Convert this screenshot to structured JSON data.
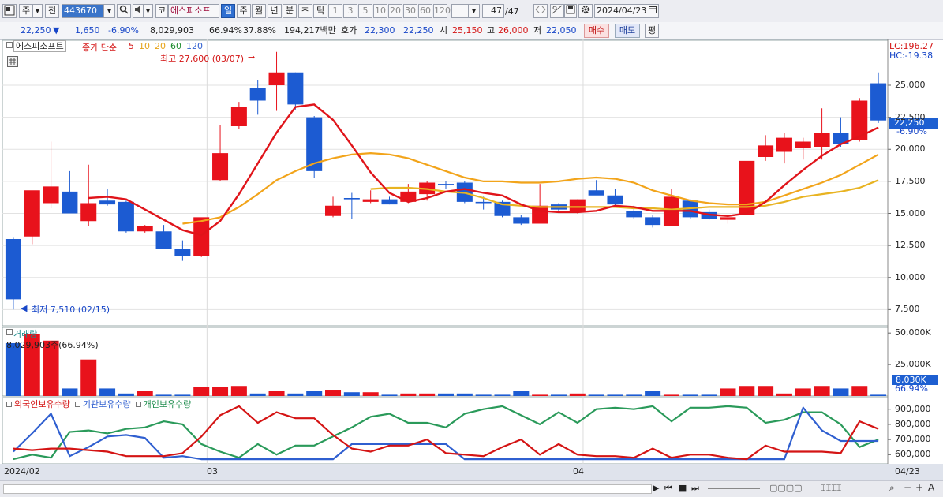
{
  "toolbar": {
    "menu_icon": "window-icon",
    "market_label": "주",
    "prev_label": "전",
    "stock_code": "443670",
    "search_icon": "search-icon",
    "sound_icon": "speaker-icon",
    "code_label": "코",
    "stock_name": "에스피소프",
    "periods": [
      "일",
      "주",
      "월",
      "년",
      "분",
      "초",
      "틱"
    ],
    "active_period": "일",
    "intervals": [
      "1",
      "3",
      "5",
      "10",
      "20",
      "30",
      "60",
      "120"
    ],
    "count": "47",
    "count_total": "/47",
    "date": "2024/04/23"
  },
  "quote": {
    "price": "22,250",
    "change": "1,650",
    "change_pct": "-6.90%",
    "volume": "8,029,903",
    "vol_ratio": "66.94%",
    "turnover": "37.88%",
    "amount": "194,217백만",
    "bid_label": "호가",
    "bid1": "22,300",
    "bid2": "22,250",
    "open_label": "시",
    "open": "25,150",
    "high_label": "고",
    "high": "26,000",
    "low_label": "저",
    "low": "22,050",
    "buy_label": "매수",
    "sell_label": "매도",
    "eval_label": "평"
  },
  "price_panel": {
    "stock_name": "에스피소프트",
    "ma_title": "종가 단순",
    "ma_periods": [
      {
        "label": "5",
        "color": "#d41414"
      },
      {
        "label": "10",
        "color": "#e3a21b"
      },
      {
        "label": "20",
        "color": "#e8a316"
      },
      {
        "label": "60",
        "color": "#1a8a2a"
      },
      {
        "label": "120",
        "color": "#2f5fd0"
      }
    ],
    "lc": "LC:196.27",
    "hc": "HC:-19.38",
    "max_note": "최고 27,600 (03/07)",
    "min_note": "최저 7,510 (02/15)",
    "current_price": "22,250",
    "current_pct": "-6.90%",
    "y_ticks": [
      "25,000",
      "22,500",
      "20,000",
      "17,500",
      "15,000",
      "12,500",
      "10,000",
      "7,500"
    ]
  },
  "volume_panel": {
    "title": "거래량",
    "note": "8,029,903주(66.94%)",
    "current": "8,030K",
    "current_pct": "66.94%",
    "y_ticks": [
      "50,000K",
      "25,000K"
    ]
  },
  "holding_panel": {
    "series": [
      {
        "name": "외국인보유수량",
        "color": "#d41414"
      },
      {
        "name": "기관보유수량",
        "color": "#2f5fd0"
      },
      {
        "name": "개인보유수량",
        "color": "#1a8a4a"
      }
    ],
    "y_ticks": [
      "900,000",
      "800,000",
      "700,000",
      "600,000"
    ]
  },
  "x_axis": {
    "labels": [
      "2024/02",
      "03",
      "04"
    ],
    "right_label": "04/23"
  },
  "chart_data": {
    "type": "candlestick",
    "price_ylim": [
      6600,
      28200
    ],
    "candles": [
      {
        "o": 13000,
        "h": 13100,
        "l": 7510,
        "c": 8300
      },
      {
        "o": 13200,
        "h": 15900,
        "l": 12600,
        "c": 16800
      },
      {
        "o": 15800,
        "h": 20600,
        "l": 15400,
        "c": 17100
      },
      {
        "o": 16700,
        "h": 18300,
        "l": 15000,
        "c": 15000
      },
      {
        "o": 14400,
        "h": 18800,
        "l": 14000,
        "c": 15800
      },
      {
        "o": 16000,
        "h": 16900,
        "l": 15600,
        "c": 15700
      },
      {
        "o": 15900,
        "h": 16000,
        "l": 13500,
        "c": 13600
      },
      {
        "o": 13600,
        "h": 14100,
        "l": 13500,
        "c": 14000
      },
      {
        "o": 13600,
        "h": 14100,
        "l": 12200,
        "c": 12200
      },
      {
        "o": 12200,
        "h": 12900,
        "l": 11300,
        "c": 11700
      },
      {
        "o": 11700,
        "h": 14400,
        "l": 11600,
        "c": 14700
      },
      {
        "o": 17600,
        "h": 21900,
        "l": 17500,
        "c": 19700
      },
      {
        "o": 21800,
        "h": 23700,
        "l": 21600,
        "c": 23300
      },
      {
        "o": 24800,
        "h": 25400,
        "l": 22700,
        "c": 23800
      },
      {
        "o": 25000,
        "h": 27600,
        "l": 23000,
        "c": 26000
      },
      {
        "o": 26000,
        "h": 26000,
        "l": 23100,
        "c": 23500
      },
      {
        "o": 22500,
        "h": 22600,
        "l": 17800,
        "c": 18300
      },
      {
        "o": 14800,
        "h": 16300,
        "l": 14700,
        "c": 15600
      },
      {
        "o": 16200,
        "h": 16600,
        "l": 14600,
        "c": 16100
      },
      {
        "o": 15900,
        "h": 16800,
        "l": 15800,
        "c": 16100
      },
      {
        "o": 16100,
        "h": 16300,
        "l": 15700,
        "c": 15700
      },
      {
        "o": 15900,
        "h": 17300,
        "l": 15800,
        "c": 16700
      },
      {
        "o": 16500,
        "h": 17500,
        "l": 16000,
        "c": 17400
      },
      {
        "o": 17300,
        "h": 17500,
        "l": 16900,
        "c": 17200
      },
      {
        "o": 17400,
        "h": 17500,
        "l": 15800,
        "c": 15900
      },
      {
        "o": 15900,
        "h": 16300,
        "l": 15300,
        "c": 15800
      },
      {
        "o": 15900,
        "h": 16000,
        "l": 14700,
        "c": 14800
      },
      {
        "o": 14700,
        "h": 14900,
        "l": 14100,
        "c": 14200
      },
      {
        "o": 14200,
        "h": 17300,
        "l": 14200,
        "c": 15600
      },
      {
        "o": 15700,
        "h": 15800,
        "l": 15100,
        "c": 15300
      },
      {
        "o": 15100,
        "h": 16100,
        "l": 15000,
        "c": 16100
      },
      {
        "o": 16800,
        "h": 17600,
        "l": 16700,
        "c": 16400
      },
      {
        "o": 16400,
        "h": 16900,
        "l": 15500,
        "c": 15700
      },
      {
        "o": 15200,
        "h": 15600,
        "l": 14600,
        "c": 14700
      },
      {
        "o": 14700,
        "h": 14900,
        "l": 13900,
        "c": 14100
      },
      {
        "o": 14000,
        "h": 16900,
        "l": 14000,
        "c": 16300
      },
      {
        "o": 16000,
        "h": 16100,
        "l": 14600,
        "c": 14700
      },
      {
        "o": 15100,
        "h": 15300,
        "l": 14500,
        "c": 14600
      },
      {
        "o": 14500,
        "h": 14900,
        "l": 14200,
        "c": 14700
      },
      {
        "o": 14900,
        "h": 15700,
        "l": 14900,
        "c": 19100
      },
      {
        "o": 19400,
        "h": 21100,
        "l": 19100,
        "c": 20300
      },
      {
        "o": 19800,
        "h": 21300,
        "l": 18900,
        "c": 20900
      },
      {
        "o": 20100,
        "h": 20900,
        "l": 19200,
        "c": 20600
      },
      {
        "o": 20200,
        "h": 23200,
        "l": 19200,
        "c": 21300
      },
      {
        "o": 21300,
        "h": 22500,
        "l": 20200,
        "c": 20400
      },
      {
        "o": 20700,
        "h": 24000,
        "l": 20600,
        "c": 23800
      },
      {
        "o": 25150,
        "h": 26000,
        "l": 22050,
        "c": 22250
      }
    ],
    "ma5": [
      null,
      null,
      null,
      null,
      16200,
      16300,
      16100,
      15300,
      14500,
      13700,
      13300,
      14400,
      16500,
      18900,
      21300,
      23300,
      23500,
      22300,
      20300,
      18200,
      16600,
      15900,
      16200,
      16700,
      16900,
      16600,
      16400,
      15700,
      15200,
      15100,
      15100,
      15200,
      15600,
      15500,
      15200,
      15200,
      15200,
      14900,
      14800,
      15000,
      15900,
      17200,
      18400,
      19500,
      20400,
      21000,
      21700
    ],
    "ma20": [
      null,
      null,
      null,
      null,
      null,
      null,
      null,
      null,
      null,
      14200,
      14400,
      14700,
      15500,
      16500,
      17600,
      18300,
      18900,
      19300,
      19600,
      19700,
      19600,
      19300,
      18800,
      18300,
      17800,
      17500,
      17500,
      17400,
      17400,
      17500,
      17700,
      17800,
      17700,
      17400,
      16800,
      16400,
      16000,
      15800,
      15700,
      15700,
      15900,
      16400,
      16900,
      17400,
      18000,
      18800,
      19600
    ],
    "ma10": [
      null,
      null,
      null,
      null,
      null,
      null,
      null,
      null,
      null,
      null,
      null,
      null,
      null,
      null,
      null,
      null,
      null,
      null,
      null,
      16900,
      17000,
      17000,
      16900,
      16700,
      16600,
      16200,
      15700,
      15600,
      15500,
      15500,
      15500,
      15500,
      15500,
      15400,
      15400,
      15300,
      15400,
      15500,
      15500,
      15500,
      15600,
      15900,
      16300,
      16500,
      16700,
      17000,
      17600
    ],
    "volumes": [
      42,
      49,
      44,
      6,
      29,
      6,
      2,
      4,
      1,
      1,
      7,
      7,
      8,
      2,
      4,
      2,
      4,
      5,
      3,
      3,
      1,
      2,
      2,
      2,
      2,
      1,
      1,
      4,
      1,
      1,
      2,
      1,
      1,
      1,
      4,
      1,
      1,
      1,
      6,
      8,
      8,
      2,
      6,
      8,
      6,
      8,
      1
    ],
    "volume_ylim": [
      0,
      52000
    ],
    "foreign": [
      640000,
      630000,
      640000,
      640000,
      630000,
      620000,
      590000,
      590000,
      590000,
      610000,
      720000,
      860000,
      920000,
      810000,
      880000,
      840000,
      840000,
      730000,
      640000,
      620000,
      660000,
      660000,
      700000,
      610000,
      600000,
      590000,
      650000,
      700000,
      600000,
      670000,
      600000,
      590000,
      590000,
      580000,
      640000,
      580000,
      600000,
      600000,
      580000,
      570000,
      660000,
      620000,
      620000,
      620000,
      610000,
      820000,
      770000
    ],
    "institution": [
      620000,
      740000,
      870000,
      590000,
      650000,
      720000,
      730000,
      710000,
      580000,
      590000,
      570000,
      570000,
      570000,
      570000,
      570000,
      570000,
      570000,
      570000,
      670000,
      670000,
      670000,
      670000,
      670000,
      670000,
      570000,
      570000,
      570000,
      570000,
      570000,
      570000,
      570000,
      570000,
      570000,
      570000,
      570000,
      570000,
      570000,
      570000,
      570000,
      570000,
      570000,
      570000,
      910000,
      760000,
      690000,
      690000,
      690000
    ],
    "individual": [
      570000,
      600000,
      580000,
      750000,
      760000,
      740000,
      770000,
      780000,
      820000,
      800000,
      670000,
      620000,
      580000,
      670000,
      600000,
      660000,
      660000,
      720000,
      780000,
      850000,
      870000,
      810000,
      810000,
      780000,
      870000,
      900000,
      920000,
      860000,
      800000,
      880000,
      810000,
      900000,
      910000,
      900000,
      920000,
      820000,
      910000,
      910000,
      920000,
      910000,
      810000,
      830000,
      880000,
      880000,
      800000,
      650000,
      700000
    ],
    "holding_ylim": [
      560000,
      935000
    ]
  }
}
